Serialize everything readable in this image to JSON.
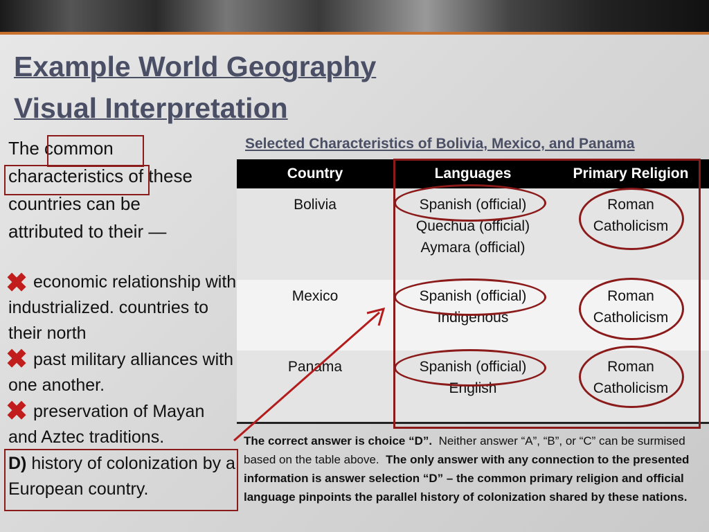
{
  "slide": {
    "title_line1": "Example World Geography",
    "title_line2": "Visual Interpretation"
  },
  "question": {
    "word_the": "The",
    "word_common": "common",
    "word_characteristics": "characteristics",
    "rest1": "of these",
    "rest2": "countries can be",
    "rest3": "attributed to their —"
  },
  "options": {
    "a": "economic relationship with industrialized. countries to their north",
    "b": "past military alliances with one another.",
    "c": "preservation of Mayan and Aztec traditions.",
    "d_letter": "D)",
    "d": "history of colonization by a European country."
  },
  "table": {
    "title": "Selected Characteristics of Bolivia, Mexico, and Panama",
    "headers": [
      "Country",
      "Languages",
      "Primary Religion"
    ],
    "rows": [
      {
        "country": "Bolivia",
        "languages": [
          "Spanish (official)",
          "Quechua (official)",
          "Aymara (official)"
        ],
        "religion": [
          "Roman",
          "Catholicism"
        ]
      },
      {
        "country": "Mexico",
        "languages": [
          "Spanish (official)",
          "Indigenous"
        ],
        "religion": [
          "Roman",
          "Catholicism"
        ]
      },
      {
        "country": "Panama",
        "languages": [
          "Spanish (official)",
          "English"
        ],
        "religion": [
          "Roman",
          "Catholicism"
        ]
      }
    ]
  },
  "answer": {
    "bold1": "The correct answer is choice “D”.",
    "normal": "Neither answer “A”, “B”, or “C” can be surmised based on the table above.",
    "bold2": "The only answer with any connection to the presented information is answer selection “D” – the common primary religion and official language pinpoints the parallel history of colonization shared by these nations."
  },
  "colors": {
    "accent_red": "#8b1a1a",
    "x_red": "#c21d1d",
    "title_slate": "#4a4f66",
    "banner_orange": "#c8702d"
  }
}
